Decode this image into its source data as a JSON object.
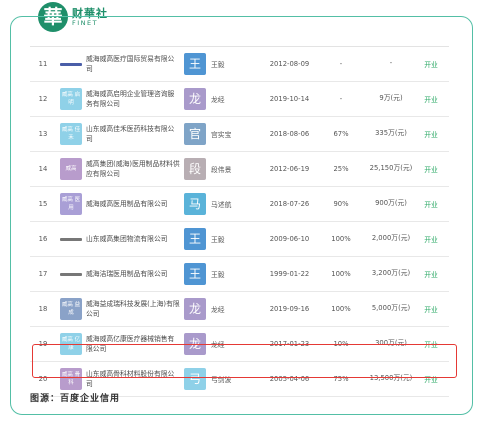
{
  "logo": {
    "char": "華",
    "cn": "财華社",
    "en": "FINET"
  },
  "source": "图源：百度企业信用",
  "colors": {
    "accent": "#1f8f6a",
    "frame": "#53bfa6",
    "highlight": "#e53935",
    "status": "#2aa865"
  },
  "rows": [
    {
      "idx": "11",
      "logo": {
        "type": "wordmark",
        "color": "#4a5ea8",
        "text": ""
      },
      "company": "威海威高医疗国际贸易有限公司",
      "avatar": {
        "char": "王",
        "color": "#4f95d3"
      },
      "person": "王毅",
      "date": "2012-08-09",
      "ratio": "-",
      "capital": "-",
      "status": "开业"
    },
    {
      "idx": "12",
      "logo": {
        "type": "box",
        "color": "#8fd1e8",
        "text": "威高 启明"
      },
      "company": "威海威高启明企业管理咨询服务有限公司",
      "avatar": {
        "char": "龙",
        "color": "#a99acb"
      },
      "person": "龙经",
      "date": "2019-10-14",
      "ratio": "-",
      "capital": "9万(元)",
      "status": "开业"
    },
    {
      "idx": "13",
      "logo": {
        "type": "box",
        "color": "#8fd1e8",
        "text": "威高 佳禾"
      },
      "company": "山东威高佳禾医药科技有限公司",
      "avatar": {
        "char": "官",
        "color": "#7fa4c7"
      },
      "person": "宫实宝",
      "date": "2018-08-06",
      "ratio": "67%",
      "capital": "335万(元)",
      "status": "开业"
    },
    {
      "idx": "14",
      "logo": {
        "type": "box",
        "color": "#b89ccc",
        "text": "威高"
      },
      "company": "威高集团(威海)医用制品材料供应有限公司",
      "avatar": {
        "char": "段",
        "color": "#b8aeb3"
      },
      "person": "段伟景",
      "date": "2012-06-19",
      "ratio": "25%",
      "capital": "25,150万(元)",
      "status": "开业"
    },
    {
      "idx": "15",
      "logo": {
        "type": "box",
        "color": "#a99fd6",
        "text": "威高 医用"
      },
      "company": "威海威高医用制品有限公司",
      "avatar": {
        "char": "马",
        "color": "#5ab3d9"
      },
      "person": "马述航",
      "date": "2018-07-26",
      "ratio": "90%",
      "capital": "900万(元)",
      "status": "开业"
    },
    {
      "idx": "16",
      "logo": {
        "type": "wordmark",
        "color": "#777777",
        "text": ""
      },
      "company": "山东威高集团物流有限公司",
      "avatar": {
        "char": "王",
        "color": "#4f95d3"
      },
      "person": "王毅",
      "date": "2009-06-10",
      "ratio": "100%",
      "capital": "2,000万(元)",
      "status": "开业"
    },
    {
      "idx": "17",
      "logo": {
        "type": "wordmark",
        "color": "#777777",
        "text": ""
      },
      "company": "威海洁瑞医用制品有限公司",
      "avatar": {
        "char": "王",
        "color": "#4f95d3"
      },
      "person": "王毅",
      "date": "1999-01-22",
      "ratio": "100%",
      "capital": "3,200万(元)",
      "status": "开业"
    },
    {
      "idx": "18",
      "logo": {
        "type": "box",
        "color": "#8aa2c8",
        "text": "威高 益成"
      },
      "company": "威海益成瑞科技发展(上海)有限公司",
      "avatar": {
        "char": "龙",
        "color": "#a99acb"
      },
      "person": "龙经",
      "date": "2019-09-16",
      "ratio": "100%",
      "capital": "5,000万(元)",
      "status": "开业"
    },
    {
      "idx": "19",
      "logo": {
        "type": "box",
        "color": "#8fd1e8",
        "text": "威高 亿康"
      },
      "company": "威海威高亿康医疗器械销售有限公司",
      "avatar": {
        "char": "龙",
        "color": "#a99acb"
      },
      "person": "龙经",
      "date": "2017-01-23",
      "ratio": "10%",
      "capital": "300万(元)",
      "status": "开业"
    },
    {
      "idx": "20",
      "logo": {
        "type": "box",
        "color": "#b89ccc",
        "text": "威高 骨科"
      },
      "company": "山东威高骨科材料股份有限公司",
      "avatar": {
        "char": "弓",
        "color": "#8fd1e8"
      },
      "person": "弓剑波",
      "date": "2005-04-06",
      "ratio": "75%",
      "capital": "13,500万(元)",
      "status": "开业"
    }
  ]
}
